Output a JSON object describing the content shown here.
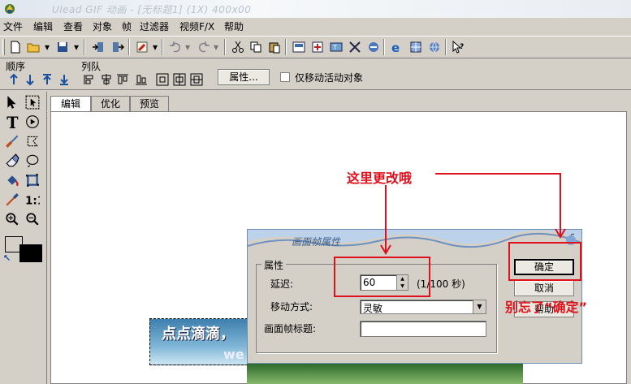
{
  "window": {
    "title": "Ulead GIF 动画 - [无标题1] (1X) 400x00"
  },
  "menu": [
    "文件",
    "编辑",
    "查看",
    "对象",
    "帧",
    "过滤器",
    "视频F/X",
    "帮助"
  ],
  "toolbar2": {
    "order_label": "顺序",
    "queue_label": "列队",
    "properties_button": "属性...",
    "only_move_active_label": "仅移动活动对象"
  },
  "tabs": [
    "编辑",
    "优化",
    "预览"
  ],
  "canvas": {
    "gif_text": "点点滴滴，",
    "gif_text2": "we"
  },
  "dialog": {
    "title": "画面帧属性",
    "group_label": "属性",
    "delay_label": "延迟:",
    "delay_value": "60",
    "delay_unit": "(1/100 秒)",
    "move_mode_label": "移动方式:",
    "move_mode_value": "灵敏",
    "frame_title_label": "画面帧标题:",
    "frame_title_value": "",
    "ok_button": "确定",
    "cancel_button": "取消",
    "help_button": "帮助"
  },
  "annotations": {
    "change_here": "这里更改哦",
    "dont_forget": "别忘了“确定”"
  },
  "colors": {
    "annotation_red": "#e0101b",
    "chrome": "#d4d0c8"
  }
}
